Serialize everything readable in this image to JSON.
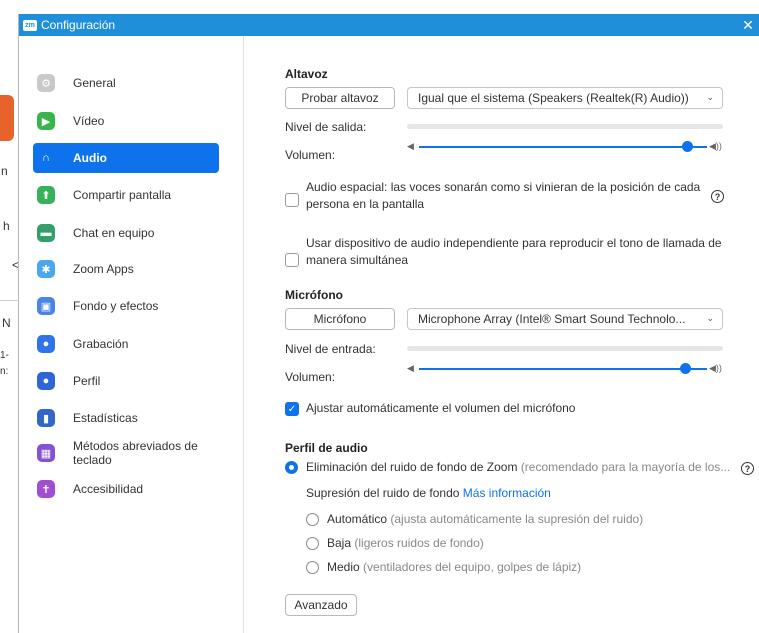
{
  "window": {
    "title": "Configuración",
    "logo_text": "zm",
    "close_glyph": "✕"
  },
  "background": {
    "chars": [
      "n",
      "h",
      "<",
      "N",
      "1-",
      "n:"
    ]
  },
  "sidebar": {
    "items": [
      {
        "label": "General",
        "icon": "gear-icon",
        "glyph": "⚙",
        "color": "#c9c9c9"
      },
      {
        "label": "Vídeo",
        "icon": "video-icon",
        "glyph": "▶",
        "color": "#38b54a"
      },
      {
        "label": "Audio",
        "icon": "headphones-icon",
        "glyph": "∩",
        "color": "#0e72ed"
      },
      {
        "label": "Compartir pantalla",
        "icon": "share-screen-icon",
        "glyph": "⬆",
        "color": "#36b25a"
      },
      {
        "label": "Chat en equipo",
        "icon": "chat-icon",
        "glyph": "▬",
        "color": "#33a06a"
      },
      {
        "label": "Zoom Apps",
        "icon": "apps-icon",
        "glyph": "✱",
        "color": "#4aa7ee"
      },
      {
        "label": "Fondo y efectos",
        "icon": "background-icon",
        "glyph": "▣",
        "color": "#4a84e6"
      },
      {
        "label": "Grabación",
        "icon": "record-icon",
        "glyph": "●",
        "color": "#2f74e8"
      },
      {
        "label": "Perfil",
        "icon": "profile-icon",
        "glyph": "●",
        "color": "#2f66d6"
      },
      {
        "label": "Estadísticas",
        "icon": "stats-icon",
        "glyph": "▮",
        "color": "#3266c8"
      },
      {
        "label": "Métodos abreviados de teclado",
        "icon": "keyboard-icon",
        "glyph": "▦",
        "color": "#8552d6"
      },
      {
        "label": "Accesibilidad",
        "icon": "accessibility-icon",
        "glyph": "✝",
        "color": "#a14fd0"
      }
    ],
    "active_index": 2
  },
  "speaker": {
    "title": "Altavoz",
    "test_button": "Probar altavoz",
    "device": "Igual que el sistema (Speakers (Realtek(R) Audio))",
    "output_level_label": "Nivel de salida:",
    "volume_label": "Volumen:",
    "volume_level": 0.86
  },
  "options": {
    "spatial_audio": "Audio espacial: las voces sonarán como si vinieran de la posición de cada persona en la pantalla",
    "separate_device": "Usar dispositivo de audio independiente para reproducir el tono de llamada de manera simultánea"
  },
  "microphone": {
    "title": "Micrófono",
    "test_button": "Micrófono",
    "device": "Microphone Array (Intel® Smart Sound Technolo...",
    "input_level_label": "Nivel de entrada:",
    "volume_label": "Volumen:",
    "volume_level": 0.86,
    "auto_adjust": "Ajustar automáticamente el volumen del micrófono"
  },
  "audio_profile": {
    "title": "Perfil de audio",
    "noise_option": "Eliminación del ruido de fondo de Zoom",
    "noise_option_hint": "(recomendado para la mayoría de los...",
    "suppression_label": "Supresión del ruido de fondo",
    "more_info": "Más información",
    "levels": [
      {
        "label": "Automático",
        "hint": "(ajusta automáticamente la supresión del ruido)"
      },
      {
        "label": "Baja",
        "hint": "(ligeros ruidos de fondo)"
      },
      {
        "label": "Medio",
        "hint": "(ventiladores del equipo, golpes de lápiz)"
      }
    ],
    "advanced_button": "Avanzado"
  },
  "help_glyph": "?"
}
